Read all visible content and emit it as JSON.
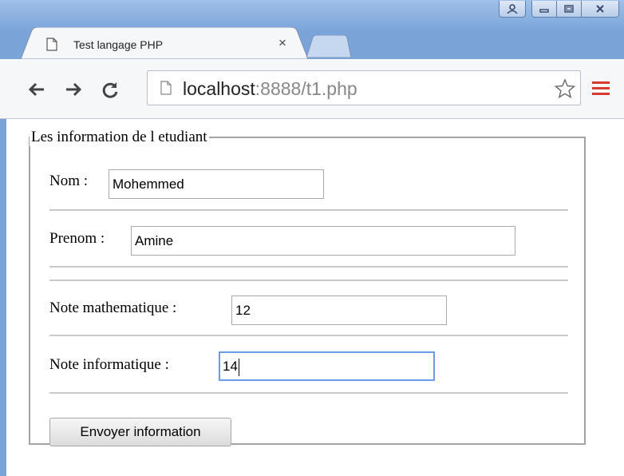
{
  "browser": {
    "tab_title": "Test langage PHP",
    "tab_close": "×",
    "url_host": "localhost",
    "url_rest": ":8888/t1.php"
  },
  "form": {
    "legend": "Les information de l etudiant",
    "nom_label": "Nom :",
    "nom_value": "Mohemmed",
    "prenom_label": "Prenom :",
    "prenom_value": "Amine",
    "math_label": "Note mathematique :",
    "math_value": "12",
    "info_label": "Note informatique :",
    "info_value": "14",
    "submit_label": "Envoyer information"
  },
  "icons": {
    "profile": "person-icon",
    "minimize": "minimize-icon",
    "maximize": "maximize-icon",
    "close": "close-icon",
    "back": "back-arrow-icon",
    "forward": "forward-arrow-icon",
    "reload": "reload-icon",
    "page": "page-icon",
    "star": "star-icon",
    "menu": "menu-icon"
  },
  "colors": {
    "menu_accent": "#d93a2f",
    "focus_border": "#6b9ae6"
  }
}
